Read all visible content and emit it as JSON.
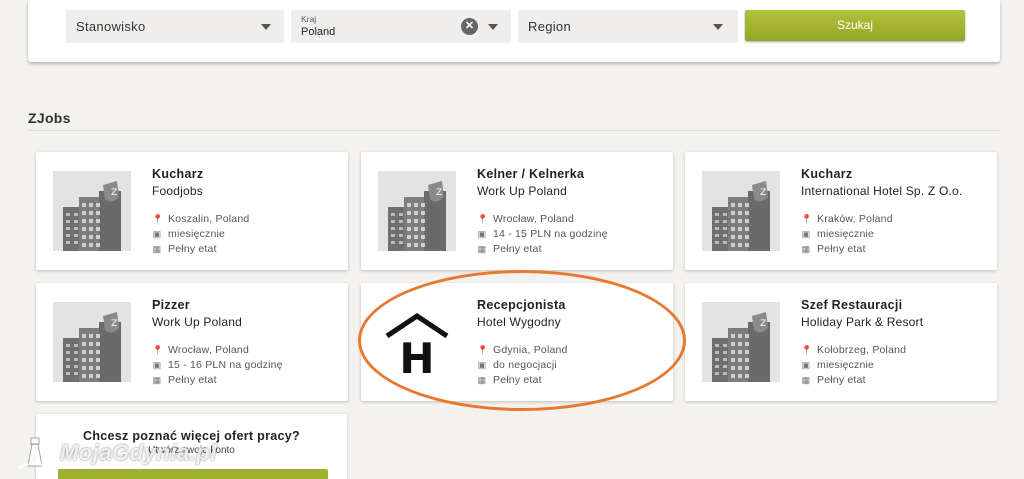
{
  "search": {
    "position_placeholder": "Stanowisko",
    "country_label": "Kraj",
    "country_value": "Poland",
    "region_placeholder": "Region",
    "search_label": "Szukaj"
  },
  "section": {
    "title": "ZJobs"
  },
  "jobs": [
    {
      "title": "Kucharz",
      "company": "Foodjobs",
      "location": "Koszalin, Poland",
      "pay": "miesięcznie",
      "type": "Pełny etat"
    },
    {
      "title": "Kelner / Kelnerka",
      "company": "Work Up Poland",
      "location": "Wrocław, Poland",
      "pay": "14 - 15 PLN na godzinę",
      "type": "Pełny etat"
    },
    {
      "title": "Kucharz",
      "company": "International Hotel Sp. Z O.o.",
      "location": "Kraków, Poland",
      "pay": "miesięcznie",
      "type": "Pełny etat"
    },
    {
      "title": "Pizzer",
      "company": "Work Up Poland",
      "location": "Wrocław, Poland",
      "pay": "15 - 16 PLN na godzinę",
      "type": "Pełny etat"
    },
    {
      "title": "Recepcjonista",
      "company": "Hotel Wygodny",
      "location": "Gdynia, Poland",
      "pay": "do negocjacji",
      "type": "Pełny etat"
    },
    {
      "title": "Szef Restauracji",
      "company": "Holiday Park & Resort",
      "location": "Kołobrzeg, Poland",
      "pay": "miesięcznie",
      "type": "Pełny etat"
    }
  ],
  "cta": {
    "title": "Chcesz poznać więcej ofert pracy?",
    "subtitle": "Utwórz swoje konto"
  },
  "watermark": {
    "text": "MojaGdynia.pl"
  },
  "colors": {
    "accent": "#a3b52f",
    "highlight": "#e8782f"
  },
  "icons": {
    "location": "location-pin-icon",
    "pay": "money-icon",
    "type": "calendar-icon",
    "placeholder": "building-icon"
  }
}
